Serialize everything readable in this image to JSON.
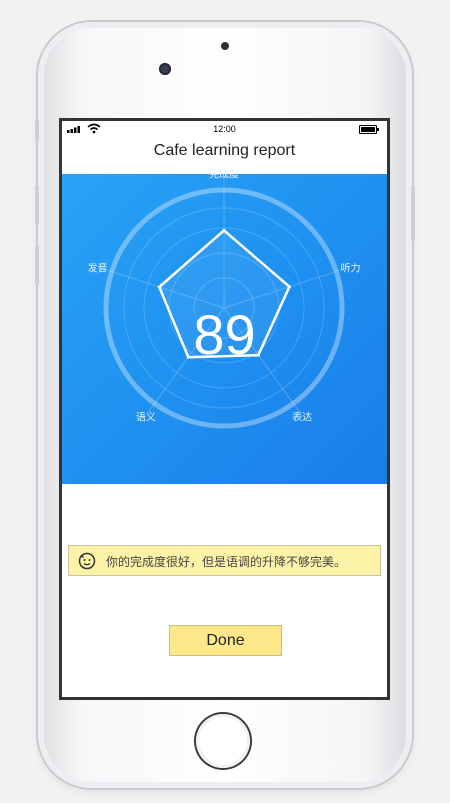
{
  "status_bar": {
    "time": "12:00"
  },
  "header": {
    "title": "Cafe learning report"
  },
  "report": {
    "score": "89",
    "axes": [
      "完成度",
      "听力",
      "表达",
      "语义",
      "发音"
    ],
    "levels": [
      0.97,
      0.86,
      0.73,
      0.76,
      0.85
    ]
  },
  "feedback": {
    "icon": "smiley-face-icon",
    "text": "你的完成度很好，但是语调的升降不够完美。"
  },
  "actions": {
    "done_label": "Done"
  },
  "colors": {
    "panel_blue": "#1e8ff0",
    "feedback_bg": "#fdf3a8",
    "done_bg": "#fde98a"
  }
}
